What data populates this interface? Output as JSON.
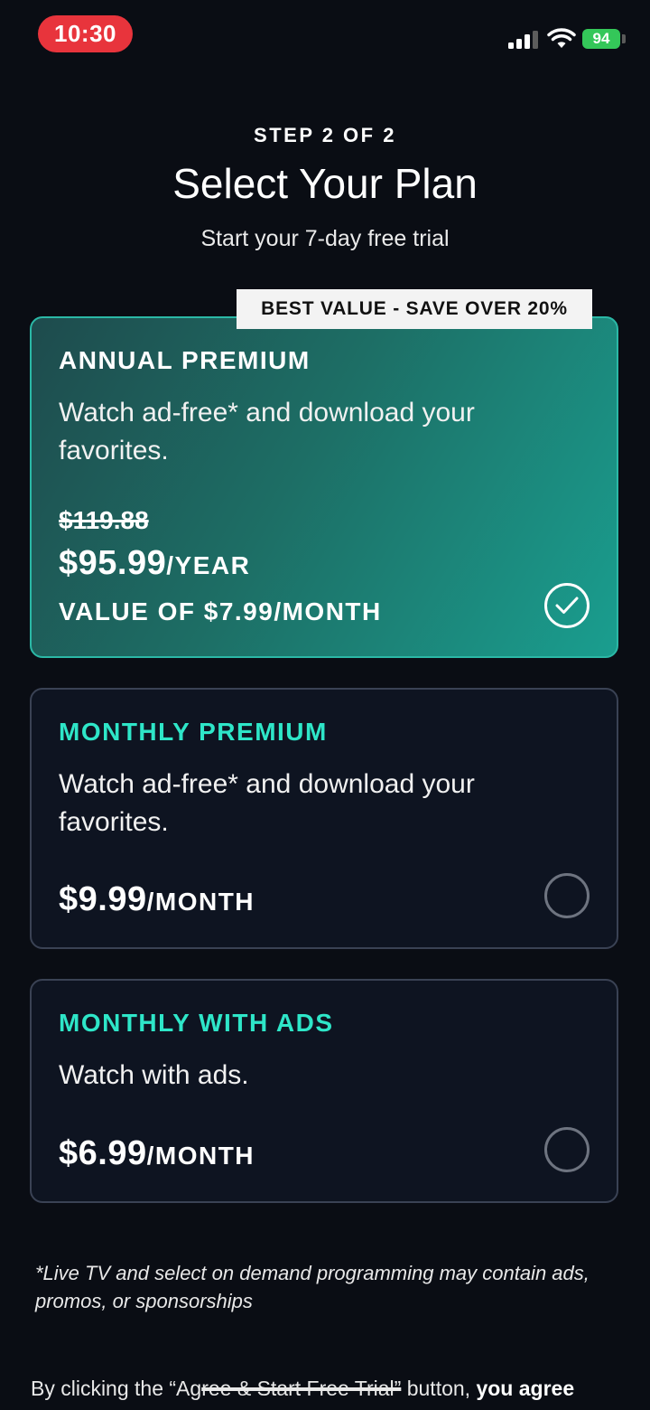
{
  "status_bar": {
    "time": "10:30",
    "battery": "94",
    "icons": [
      "signal-icon",
      "wifi-icon",
      "battery-icon"
    ]
  },
  "header": {
    "step": "STEP 2 OF 2",
    "title": "Select Your Plan",
    "subtitle": "Start your 7-day free trial"
  },
  "plans": [
    {
      "badge": "BEST VALUE - SAVE OVER 20%",
      "name": "ANNUAL PREMIUM",
      "description": "Watch ad-free* and download your favorites.",
      "old_price": "$119.88",
      "price": "$95.99",
      "price_unit": "/YEAR",
      "value_note": "VALUE OF $7.99/MONTH",
      "selected": true
    },
    {
      "name": "MONTHLY PREMIUM",
      "description": "Watch ad-free* and download your favorites.",
      "price": "$9.99",
      "price_unit": "/MONTH",
      "selected": false
    },
    {
      "name": "MONTHLY WITH ADS",
      "description": "Watch with ads.",
      "price": "$6.99",
      "price_unit": "/MONTH",
      "selected": false
    }
  ],
  "disclaimer": "*Live TV and select on demand programming may contain ads, promos, or sponsorships",
  "agree": {
    "prefix": "By clicking the “Ag",
    "button_ref": "ree & Start Free Trial”",
    "middle": " button, ",
    "bold": "you agree"
  },
  "colors": {
    "accent_teal": "#2ee6c8",
    "selected_card_gradient_end": "#1a9e8f",
    "time_pill": "#e8343c",
    "battery": "#34c759"
  }
}
